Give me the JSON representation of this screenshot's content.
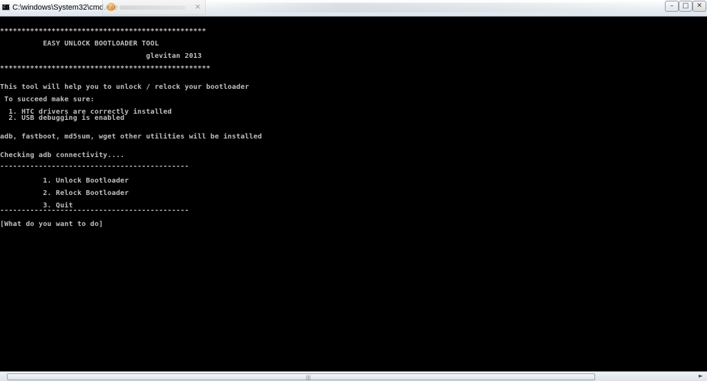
{
  "window": {
    "title": "C:\\windows\\System32\\cmd.exe",
    "icon": "console-icon",
    "icon_label": "C:\\",
    "controls": {
      "minimize": "–",
      "maximize": "□",
      "close": "✕"
    }
  },
  "background_tab": {
    "close": "×"
  },
  "console": {
    "lines": [
      "************************************************",
      "          EASY UNLOCK BOOTLOADER TOOL",
      "                                  glevitan 2013",
      "*************************************************",
      "This tool will help you to unlock / relock your bootloader",
      " To succeed make sure:",
      "  1. HTC drivers are correctly installed",
      "  2. USB debugging is enabled",
      "adb, fastboot, md5sum, wget other utilities will be installed",
      "Checking adb connectivity....",
      "--------------------------------------------",
      "          1. Unlock Bootloader",
      "          2. Relock Bootloader",
      "          3. Quit",
      "--------------------------------------------",
      "[What do you want to do]"
    ]
  },
  "scrollbar": {
    "grip": "|||",
    "arrow_right": "►"
  },
  "colors": {
    "console_bg": "#000000",
    "console_fg": "#c0c0c0"
  }
}
